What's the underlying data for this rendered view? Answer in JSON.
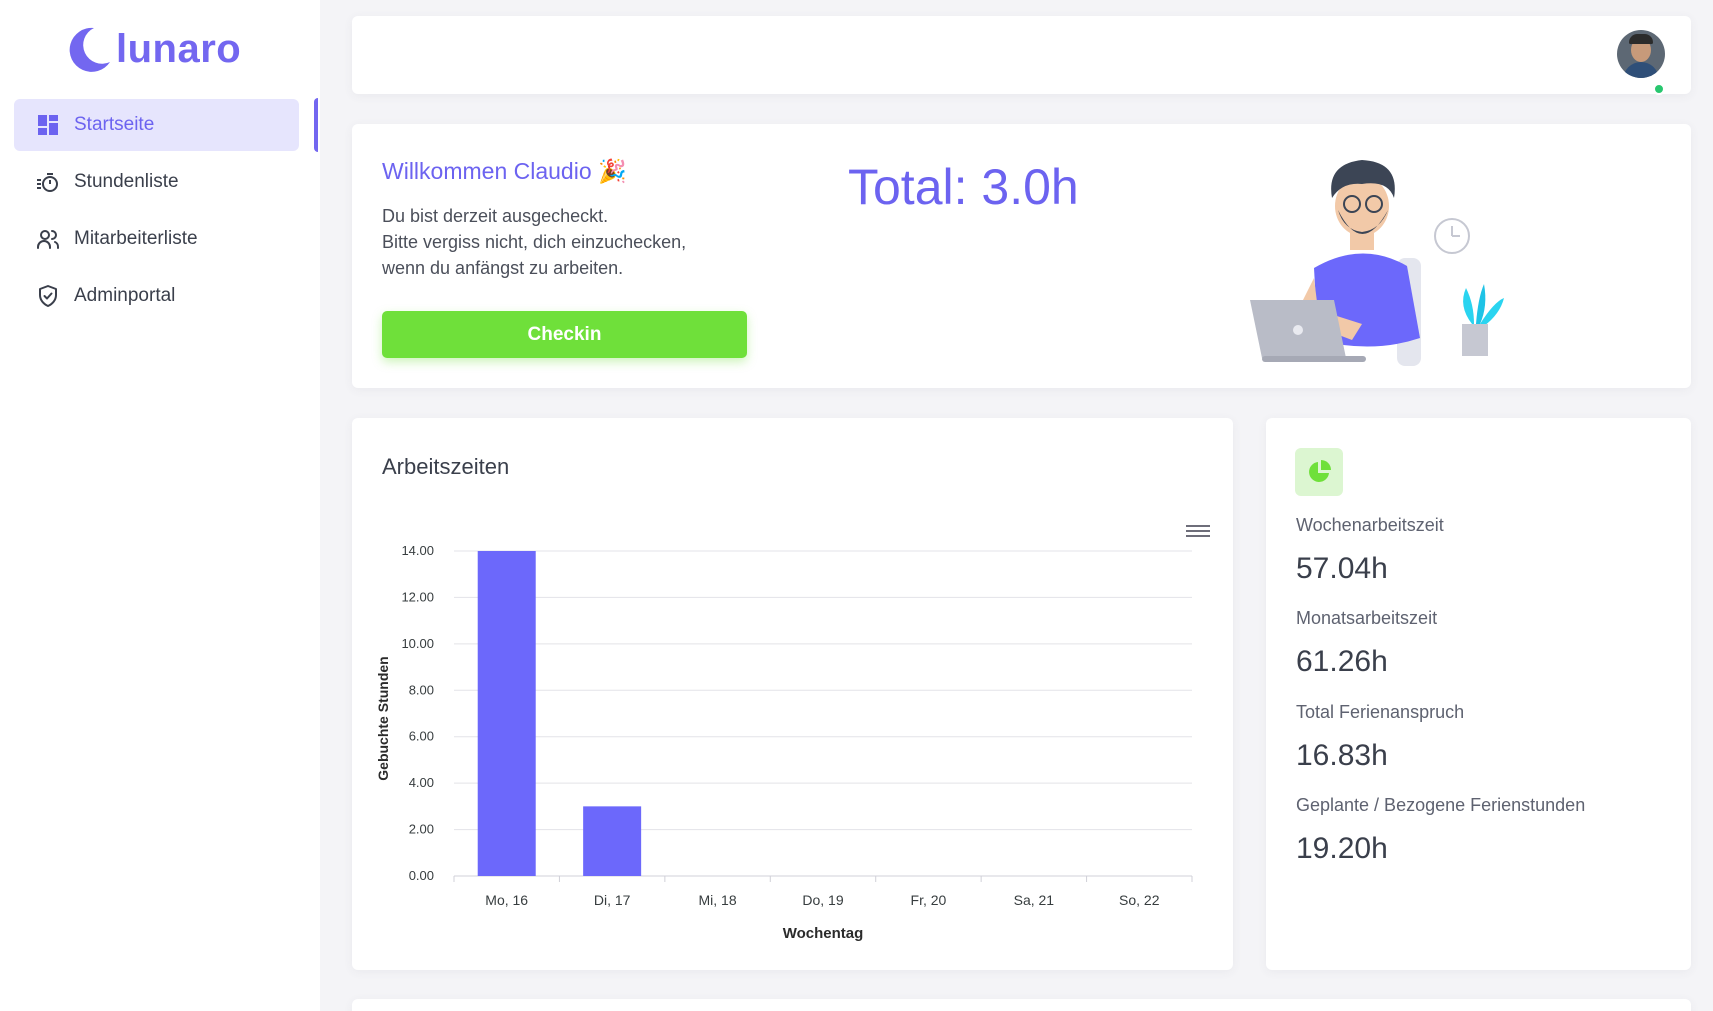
{
  "sidebar": {
    "logo_text": "lunaro",
    "items": [
      {
        "label": "Startseite",
        "icon": "dashboard-icon",
        "active": true
      },
      {
        "label": "Stundenliste",
        "icon": "timer-icon"
      },
      {
        "label": "Mitarbeiterliste",
        "icon": "users-icon"
      },
      {
        "label": "Adminportal",
        "icon": "shield-check-icon"
      }
    ]
  },
  "colors": {
    "accent": "#7367f0",
    "checkin": "#6fe03a",
    "bar": "#6c68fb"
  },
  "welcome": {
    "title": "Willkommen Claudio 🎉",
    "line1": "Du bist derzeit ausgecheckt.",
    "line2": "Bitte vergiss nicht, dich einzuchecken,",
    "line3": "wenn du anfängst zu arbeiten.",
    "checkin_label": "Checkin",
    "total": "Total: 3.0h"
  },
  "chart_card": {
    "title": "Arbeitszeiten"
  },
  "chart_data": {
    "type": "bar",
    "categories": [
      "Mo, 16",
      "Di, 17",
      "Mi, 18",
      "Do, 19",
      "Fr, 20",
      "Sa, 21",
      "So, 22"
    ],
    "values": [
      14.0,
      3.0,
      0,
      0,
      0,
      0,
      0
    ],
    "xlabel": "Wochentag",
    "ylabel": "Gebuchte Stunden",
    "ylim": [
      0,
      14
    ],
    "yticks": [
      "0.00",
      "2.00",
      "4.00",
      "6.00",
      "8.00",
      "10.00",
      "12.00",
      "14.00"
    ],
    "grid": true
  },
  "stats": [
    {
      "label": "Wochenarbeitszeit",
      "value": "57.04h"
    },
    {
      "label": "Monatsarbeitszeit",
      "value": "61.26h"
    },
    {
      "label": "Total Ferienanspruch",
      "value": "16.83h"
    },
    {
      "label": "Geplante / Bezogene Ferienstunden",
      "value": "19.20h"
    }
  ]
}
